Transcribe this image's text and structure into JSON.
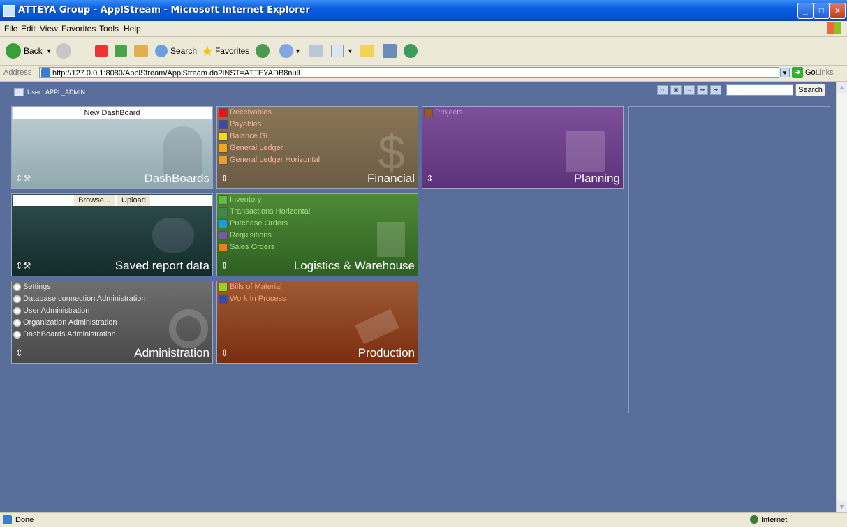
{
  "window": {
    "title": "ATTEYA Group - ApplStream - Microsoft Internet Explorer"
  },
  "menu": [
    "File",
    "Edit",
    "View",
    "Favorites",
    "Tools",
    "Help"
  ],
  "toolbar": {
    "back": "Back",
    "search": "Search",
    "favorites": "Favorites"
  },
  "address": {
    "label": "Address",
    "url": "http://127.0.0.1:8080/ApplStream/ApplStream.do?INST=ATTEYADB8null",
    "go": "Go",
    "links": "Links"
  },
  "header": {
    "user": "User : APPL_ADMIN",
    "search_button": "Search"
  },
  "tiles": {
    "dashboards": {
      "title": "DashBoards",
      "top": "New DashBoard"
    },
    "financial": {
      "title": "Financial",
      "items": [
        "Receivables",
        "Payables",
        "Balance GL",
        "General Ledger",
        "General Ledger Horizontal"
      ]
    },
    "planning": {
      "title": "Planning",
      "items": [
        "Projects"
      ]
    },
    "saved": {
      "title": "Saved report data",
      "browse": "Browse...",
      "upload": "Upload"
    },
    "logistics": {
      "title": "Logistics & Warehouse",
      "items": [
        "Inventory",
        "Transactions Horizontal",
        "Purchase Orders",
        "Requisitions",
        "Sales Orders"
      ]
    },
    "administration": {
      "title": "Administration",
      "items": [
        "Settings",
        "Database connection Administration",
        "User Administration",
        "Organization Administration",
        "DashBoards Administration"
      ]
    },
    "production": {
      "title": "Production",
      "items": [
        "Bills of Material",
        "Work In Process"
      ]
    }
  },
  "status": {
    "left": "Done",
    "zone": "Internet"
  },
  "colors": {
    "financial_items": [
      "#e8131b",
      "#3b46b0",
      "#f2dd10",
      "#f2a812",
      "#e8a02a"
    ],
    "logistics_items": [
      "#5fbf3d",
      "#3a8a4a",
      "#1e9ae0",
      "#7a58a0",
      "#ef7e14"
    ],
    "production_items": [
      "#9ad21f",
      "#3b46b0"
    ],
    "planning_items": [
      "#a0522d"
    ]
  }
}
